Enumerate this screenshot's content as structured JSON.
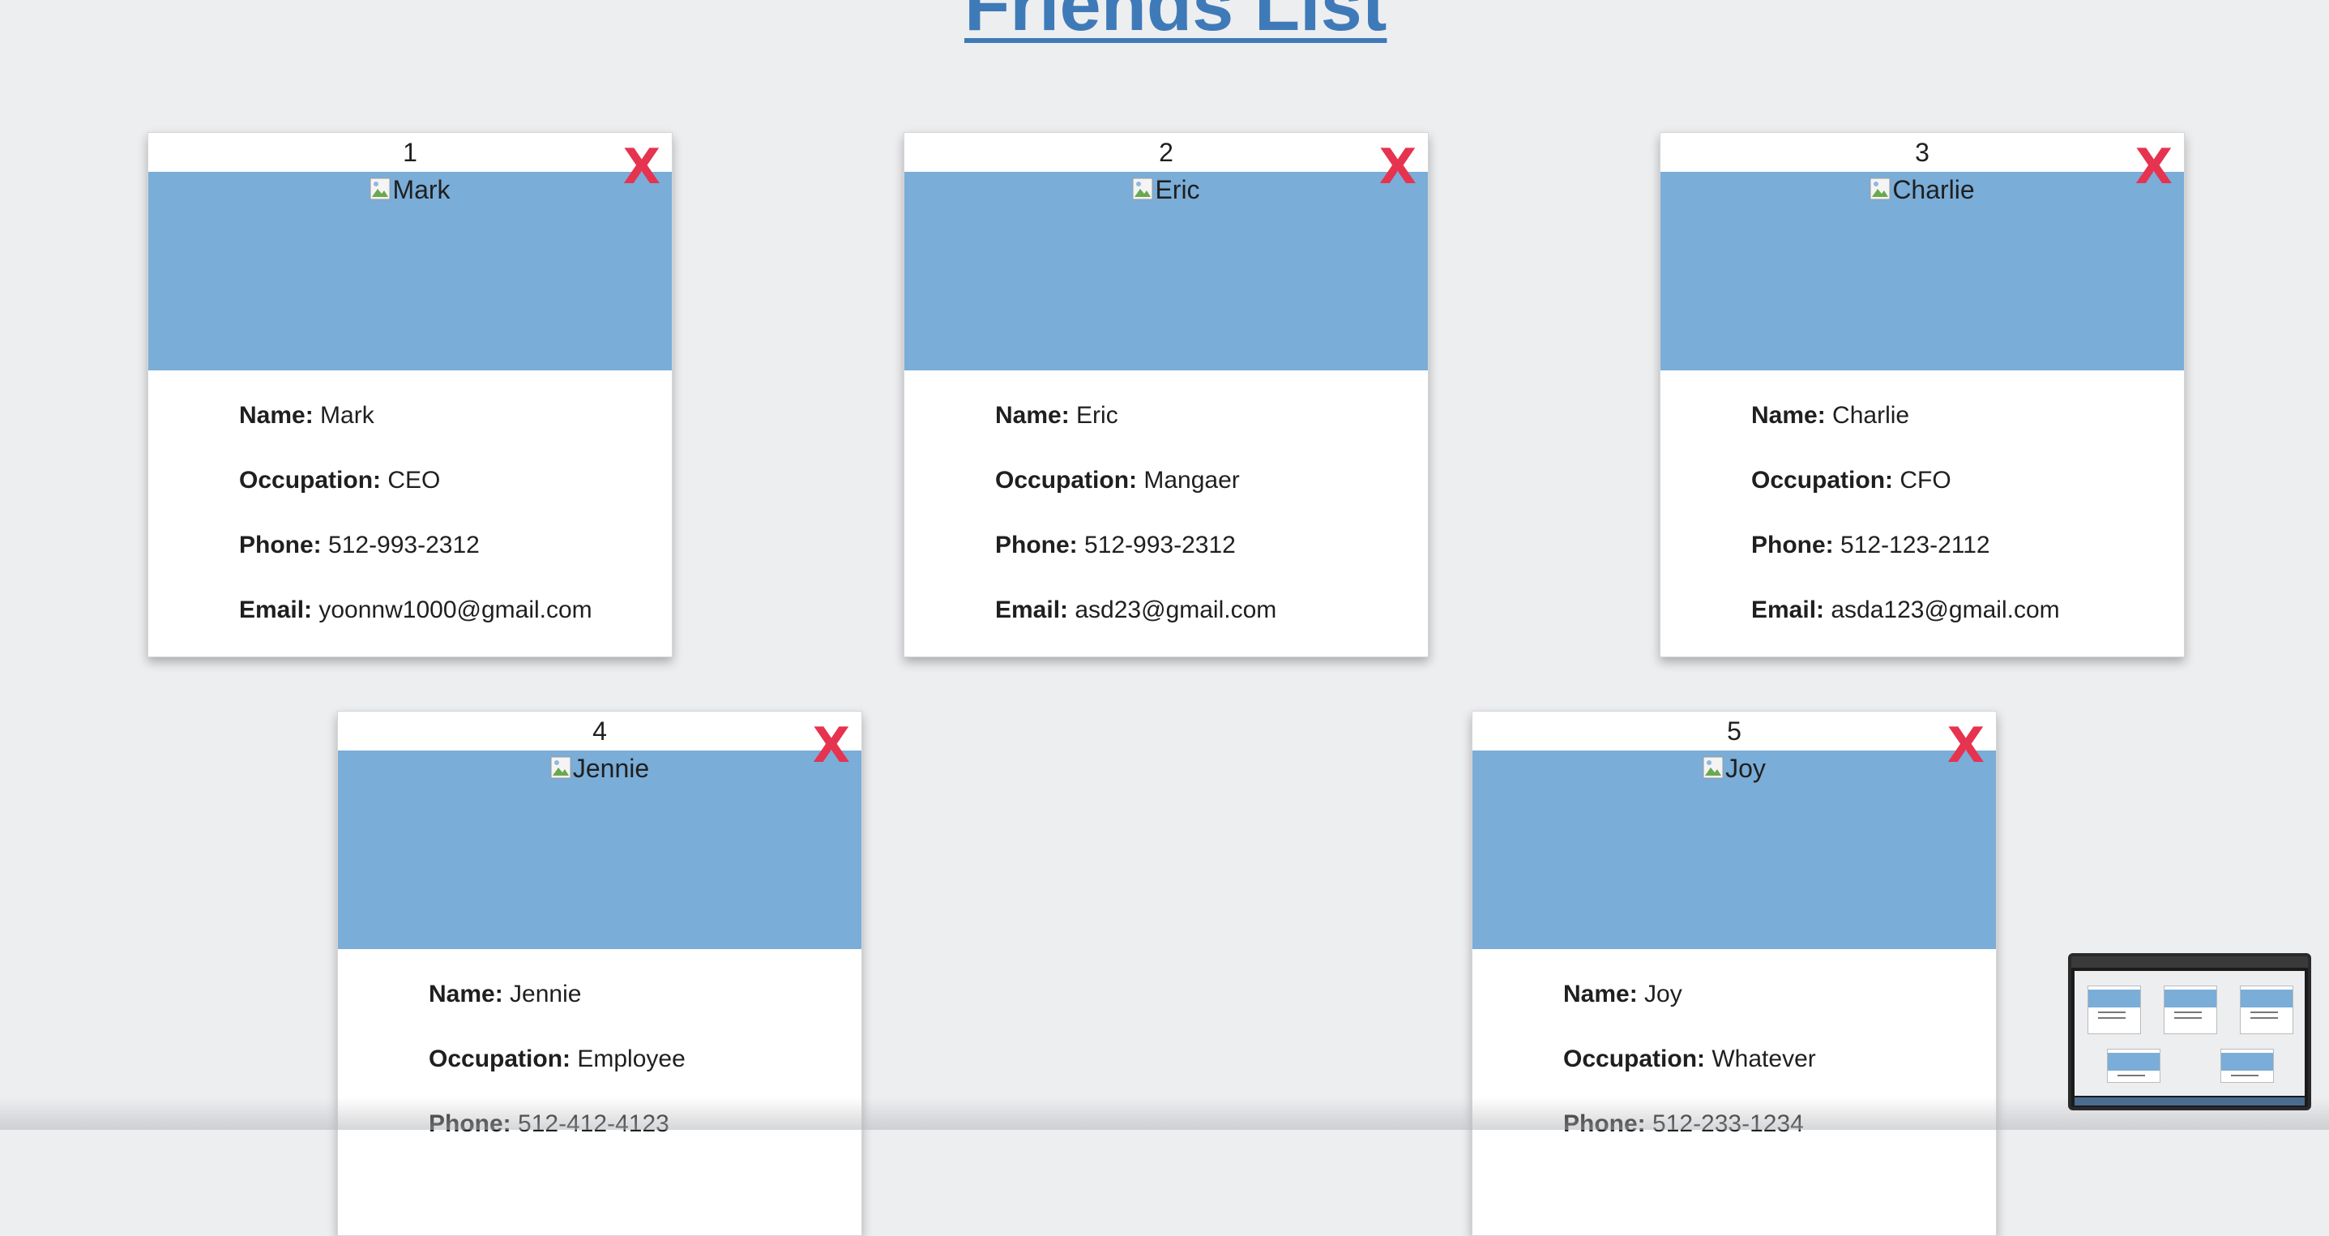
{
  "page": {
    "title": "Friends List"
  },
  "friends": [
    {
      "number": "1",
      "delete_label": "X",
      "photo_alt": "Mark",
      "name_label": "Name:",
      "name": "Mark",
      "occupation_label": "Occupation:",
      "occupation": "CEO",
      "phone_label": "Phone:",
      "phone": "512-993-2312",
      "email_label": "Email:",
      "email": "yoonnw1000@gmail.com"
    },
    {
      "number": "2",
      "delete_label": "X",
      "photo_alt": "Eric",
      "name_label": "Name:",
      "name": "Eric",
      "occupation_label": "Occupation:",
      "occupation": "Mangaer",
      "phone_label": "Phone:",
      "phone": "512-993-2312",
      "email_label": "Email:",
      "email": "asd23@gmail.com"
    },
    {
      "number": "3",
      "delete_label": "X",
      "photo_alt": "Charlie",
      "name_label": "Name:",
      "name": "Charlie",
      "occupation_label": "Occupation:",
      "occupation": "CFO",
      "phone_label": "Phone:",
      "phone": "512-123-2112",
      "email_label": "Email:",
      "email": "asda123@gmail.com"
    },
    {
      "number": "4",
      "delete_label": "X",
      "photo_alt": "Jennie",
      "name_label": "Name:",
      "name": "Jennie",
      "occupation_label": "Occupation:",
      "occupation": "Employee",
      "phone_label": "Phone:",
      "phone": "512-412-4123"
    },
    {
      "number": "5",
      "delete_label": "X",
      "photo_alt": "Joy",
      "name_label": "Name:",
      "name": "Joy",
      "occupation_label": "Occupation:",
      "occupation": "Whatever",
      "phone_label": "Phone:",
      "phone": "512-233-1234"
    }
  ],
  "colors": {
    "background": "#edeef0",
    "title": "#3f7ab8",
    "photo_area": "#7aadd8",
    "delete_button": "#e6334f",
    "card": "#ffffff"
  },
  "icons": {
    "delete": "close-icon",
    "broken_image": "broken-image-icon"
  }
}
